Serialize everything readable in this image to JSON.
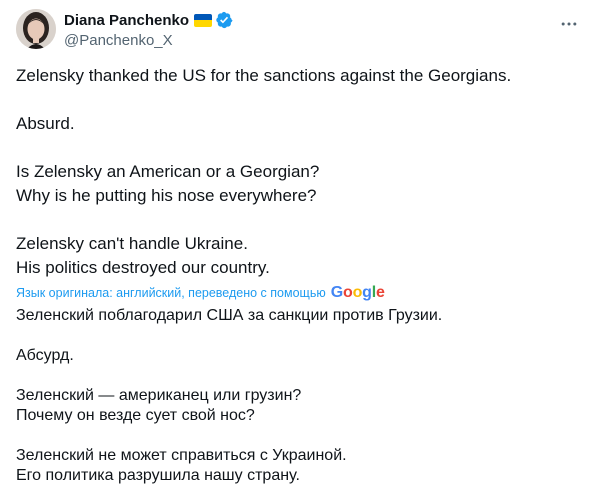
{
  "author": {
    "display_name": "Diana Panchenko",
    "handle": "@Panchenko_X",
    "flag_colors": [
      "#0057b7",
      "#ffd700"
    ],
    "verified_color": "#1d9bf0"
  },
  "tweet": {
    "paragraphs": [
      [
        "Zelensky thanked the US for the sanctions against the Georgians."
      ],
      [
        "Absurd."
      ],
      [
        "Is Zelensky an American or a Georgian?",
        "Why is he putting his nose everywhere?"
      ],
      [
        "Zelensky can't handle Ukraine.",
        "His politics destroyed our country."
      ]
    ]
  },
  "translation": {
    "label": "Язык оригинала: английский, переведено с помощью",
    "provider": "Google",
    "paragraphs": [
      [
        "Зеленский поблагодарил США за санкции против Грузии."
      ],
      [
        "Абсурд."
      ],
      [
        "Зеленский — американец или грузин?",
        "Почему он везде сует свой нос?"
      ],
      [
        "Зеленский не может справиться с Украиной.",
        "Его политика разрушила нашу страну."
      ]
    ]
  },
  "icons": {
    "more": "more-horizontal-icon",
    "verified": "verified-badge-icon",
    "flag": "ukraine-flag-icon"
  }
}
